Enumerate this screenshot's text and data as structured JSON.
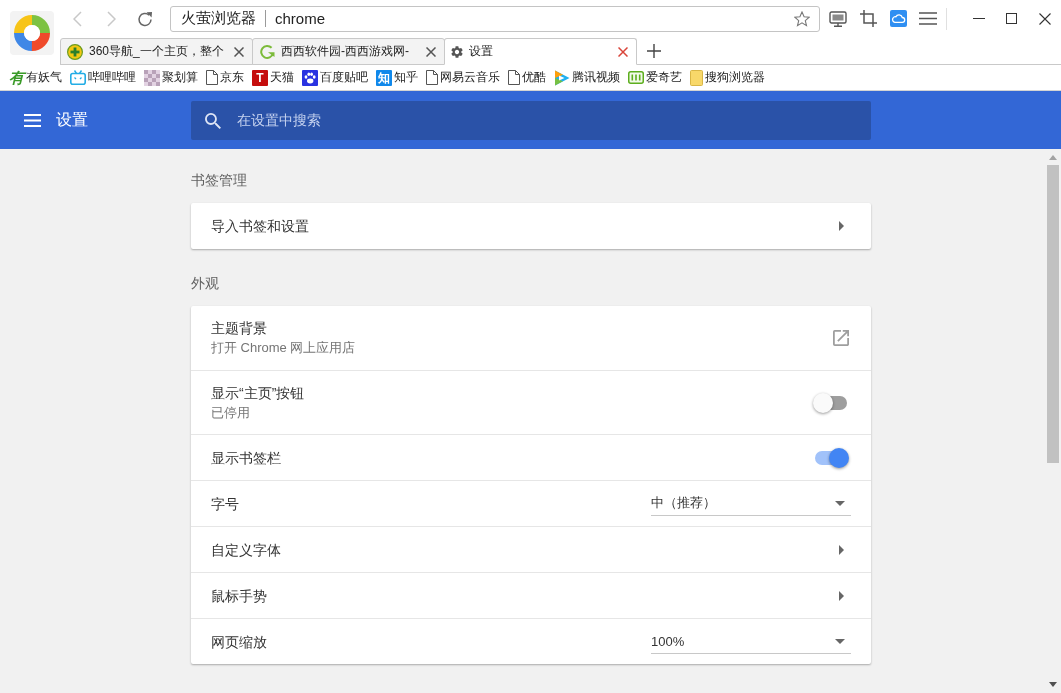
{
  "browser": {
    "nav_buttons": [
      {
        "kind": "back",
        "disabled": true
      },
      {
        "kind": "forward",
        "disabled": true
      },
      {
        "kind": "reload",
        "disabled": false
      }
    ],
    "address": {
      "site": "火萤浏览器",
      "url": "chrome"
    },
    "tabs": [
      {
        "title": "360导航_一个主页，整个",
        "selected": false
      },
      {
        "title": "西西软件园-西西游戏网-",
        "selected": false
      },
      {
        "title": "设置",
        "selected": true
      }
    ],
    "bookmarks": [
      {
        "label": "有妖气",
        "badge": "有"
      },
      {
        "label": "哔哩哔哩"
      },
      {
        "label": "聚划算"
      },
      {
        "label": "京东"
      },
      {
        "label": "天猫",
        "badge": "T"
      },
      {
        "label": "百度贴吧"
      },
      {
        "label": "知乎",
        "badge": "知"
      },
      {
        "label": "网易云音乐"
      },
      {
        "label": "优酷"
      },
      {
        "label": "腾讯视频"
      },
      {
        "label": "爱奇艺"
      },
      {
        "label": "搜狗浏览器"
      }
    ]
  },
  "settings": {
    "title": "设置",
    "search": {
      "placeholder": "在设置中搜索"
    },
    "sections": [
      {
        "title": "书签管理",
        "rows": [
          {
            "kind": "link",
            "label": "导入书签和设置"
          }
        ]
      },
      {
        "title": "外观",
        "rows": [
          {
            "kind": "external",
            "label": "主题背景",
            "sublabel": "打开 Chrome 网上应用店"
          },
          {
            "kind": "toggle",
            "label": "显示“主页”按钮",
            "sublabel": "已停用",
            "on": false
          },
          {
            "kind": "toggle",
            "label": "显示书签栏",
            "on": true
          },
          {
            "kind": "select",
            "label": "字号",
            "value": "中（推荐）"
          },
          {
            "kind": "link",
            "label": "自定义字体"
          },
          {
            "kind": "link",
            "label": "鼠标手势"
          },
          {
            "kind": "select",
            "label": "网页缩放",
            "value": "100%"
          }
        ]
      }
    ]
  }
}
